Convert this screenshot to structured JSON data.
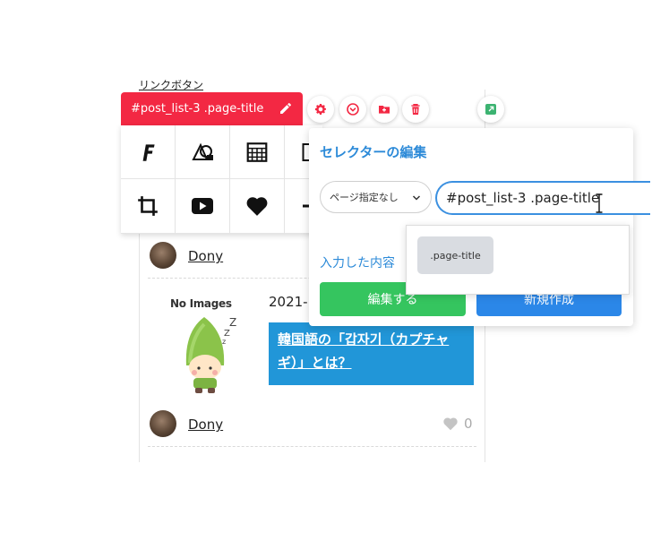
{
  "page": {
    "link_button": "リンクボタン",
    "author_1": "Dony",
    "author_2": "Dony",
    "no_images": "No Images",
    "zzz": "Z z z",
    "post_date": "2021-",
    "post_title": "韓国語の「갑자기（カプチャギ）」とは？",
    "like_count": "0"
  },
  "toolbar": {
    "selector_tag": "#post_list-3 .page-title",
    "buttons": [
      "gear-icon",
      "chevron-circle-icon",
      "folder-icon",
      "trash-icon",
      "external-link-icon"
    ],
    "grid_icons": [
      "font-icon",
      "shapes-icon",
      "table-icon",
      "layout-icon",
      "crop-icon",
      "youtube-icon",
      "heart-icon",
      "divider-icon"
    ]
  },
  "selector_editor": {
    "title": "セレクターの編集",
    "page_select_value": "ページ指定なし",
    "selector_value": "#post_list-3 .page-title",
    "preview_label": "入力した内容",
    "edit_button": "編集する",
    "new_button": "新規作成",
    "suggestion": ".page-title"
  },
  "colors": {
    "tag_red": "#f32843",
    "accent_blue": "#2c8ad8",
    "edit_green": "#35c55f",
    "new_blue": "#2b87e8",
    "post_title_bg": "#2196d8"
  }
}
